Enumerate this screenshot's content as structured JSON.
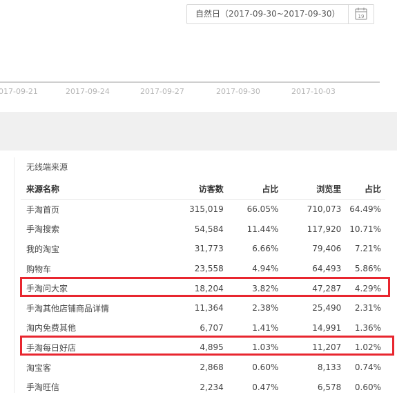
{
  "date_picker": {
    "label": "自然日（2017-09-30~2017-09-30）",
    "calendar_day": "19"
  },
  "timeline": {
    "ticks": [
      "017-09-21",
      "2017-09-24",
      "2017-09-27",
      "2017-09-30",
      "2017-10-03"
    ]
  },
  "panel": {
    "title": "无线端来源",
    "columns": [
      "来源名称",
      "访客数",
      "占比",
      "浏览里",
      "占比"
    ],
    "rows": [
      [
        "手淘首页",
        "315,019",
        "66.05%",
        "710,073",
        "64.49%"
      ],
      [
        "手淘搜索",
        "54,584",
        "11.44%",
        "117,920",
        "10.71%"
      ],
      [
        "我的淘宝",
        "31,773",
        "6.66%",
        "79,406",
        "7.21%"
      ],
      [
        "购物车",
        "23,558",
        "4.94%",
        "64,493",
        "5.86%"
      ],
      [
        "手淘问大家",
        "18,204",
        "3.82%",
        "47,287",
        "4.29%"
      ],
      [
        "手淘其他店铺商品详情",
        "11,364",
        "2.38%",
        "25,490",
        "2.31%"
      ],
      [
        "淘内免费其他",
        "6,707",
        "1.41%",
        "14,991",
        "1.36%"
      ],
      [
        "手淘每日好店",
        "4,895",
        "1.03%",
        "11,207",
        "1.02%"
      ],
      [
        "淘宝客",
        "2,868",
        "0.60%",
        "8,133",
        "0.74%"
      ],
      [
        "手淘旺信",
        "2,234",
        "0.47%",
        "6,578",
        "0.60%"
      ]
    ]
  },
  "highlight_color": "#e8262f"
}
